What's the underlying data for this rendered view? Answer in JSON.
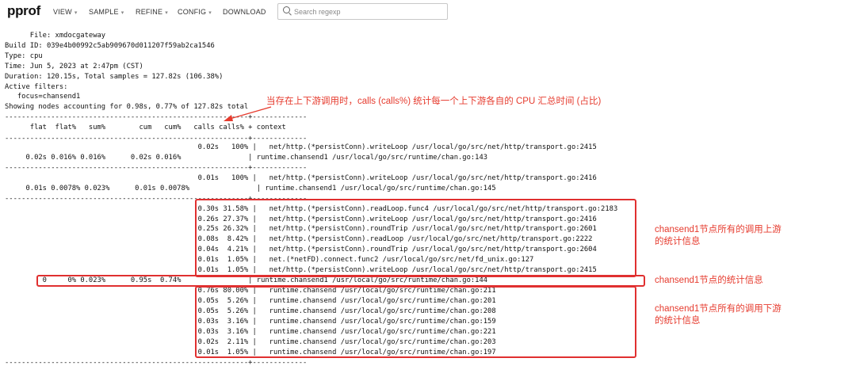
{
  "header": {
    "logo": "pprof",
    "menu": [
      {
        "label": "VIEW"
      },
      {
        "label": "SAMPLE"
      },
      {
        "label": "REFINE"
      },
      {
        "label": "CONFIG"
      },
      {
        "label": "DOWNLOAD"
      }
    ],
    "search_placeholder": "Search regexp"
  },
  "info": {
    "file": "      File: xmdocgateway",
    "build": "Build ID: 039e4b00992c5ab909670d011207f59ab2ca1546",
    "type": "Type: cpu",
    "time": "Time: Jun 5, 2023 at 2:47pm (CST)",
    "duration": "Duration: 120.15s, Total samples = 127.82s (106.38%)",
    "filters": "Active filters:",
    "focus": "   focus=chansend1",
    "showing": "Showing nodes accounting for 0.98s, 0.77% of 127.82s total"
  },
  "table": {
    "header": "      flat  flat%   sum%        cum   cum%   calls calls% + context",
    "lines": [
      "----------------------------------------------------------+-------------",
      "                                              0.02s   100% |   net/http.(*persistConn).writeLoop /usr/local/go/src/net/http/transport.go:2415",
      "     0.02s 0.016% 0.016%      0.02s 0.016%                | runtime.chansend1 /usr/local/go/src/runtime/chan.go:143",
      "----------------------------------------------------------+-------------",
      "                                              0.01s   100% |   net/http.(*persistConn).writeLoop /usr/local/go/src/net/http/transport.go:2416",
      "     0.01s 0.0078% 0.023%      0.01s 0.0078%                | runtime.chansend1 /usr/local/go/src/runtime/chan.go:145",
      "----------------------------------------------------------+-------------",
      "                                              0.30s 31.58% |   net/http.(*persistConn).readLoop.func4 /usr/local/go/src/net/http/transport.go:2183",
      "                                              0.26s 27.37% |   net/http.(*persistConn).writeLoop /usr/local/go/src/net/http/transport.go:2416",
      "                                              0.25s 26.32% |   net/http.(*persistConn).roundTrip /usr/local/go/src/net/http/transport.go:2601",
      "                                              0.08s  8.42% |   net/http.(*persistConn).readLoop /usr/local/go/src/net/http/transport.go:2222",
      "                                              0.04s  4.21% |   net/http.(*persistConn).roundTrip /usr/local/go/src/net/http/transport.go:2604",
      "                                              0.01s  1.05% |   net.(*netFD).connect.func2 /usr/local/go/src/net/fd_unix.go:127",
      "                                              0.01s  1.05% |   net/http.(*persistConn).writeLoop /usr/local/go/src/net/http/transport.go:2415",
      "         0     0% 0.023%      0.95s  0.74%                | runtime.chansend1 /usr/local/go/src/runtime/chan.go:144",
      "                                              0.76s 80.00% |   runtime.chansend /usr/local/go/src/runtime/chan.go:211",
      "                                              0.05s  5.26% |   runtime.chansend /usr/local/go/src/runtime/chan.go:201",
      "                                              0.05s  5.26% |   runtime.chansend /usr/local/go/src/runtime/chan.go:208",
      "                                              0.03s  3.16% |   runtime.chansend /usr/local/go/src/runtime/chan.go:159",
      "                                              0.03s  3.16% |   runtime.chansend /usr/local/go/src/runtime/chan.go:221",
      "                                              0.02s  2.11% |   runtime.chansend /usr/local/go/src/runtime/chan.go:203",
      "                                              0.01s  1.05% |   runtime.chansend /usr/local/go/src/runtime/chan.go:197",
      "----------------------------------------------------------+-------------"
    ]
  },
  "annotations": {
    "calls_note": "当存在上下游调用时，calls (calls%) 统计每一个上下游各自的 CPU 汇总时间 (占比)",
    "upstream_note_1": "chansend1节点所有的调用上游",
    "upstream_note_2": "的统计信息",
    "node_note": "chansend1节点的统计信息",
    "downstream_note_1": "chansend1节点所有的调用下游",
    "downstream_note_2": "的统计信息",
    "color": "#e63b2e"
  }
}
